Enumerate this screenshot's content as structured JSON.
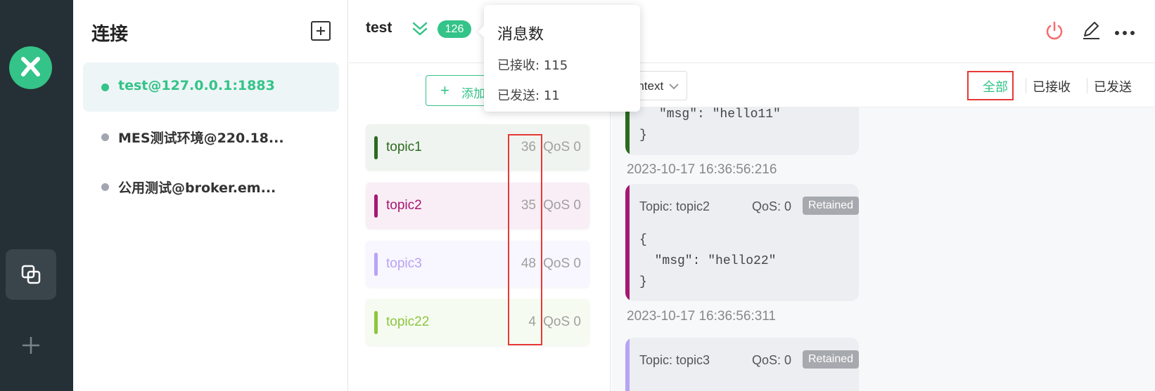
{
  "app": {
    "nav": [
      {
        "name": "connections",
        "icon": "connections-icon"
      },
      {
        "name": "new",
        "icon": "plus-icon"
      }
    ]
  },
  "sidebar": {
    "title": "连接",
    "add_icon": "plus-square-icon",
    "connections": [
      {
        "label": "test@127.0.0.1:1883",
        "status": "connected",
        "status_color": "#34c388"
      },
      {
        "label": "MES测试环境@220.18...",
        "status": "disconnected",
        "status_color": "#a2a6b0"
      },
      {
        "label": "公用测试@broker.em...",
        "status": "disconnected",
        "status_color": "#a2a6b0"
      }
    ]
  },
  "header": {
    "name": "test",
    "message_count": "126",
    "icons": [
      "collapse-icon",
      "power-icon",
      "edit-icon",
      "more-icon"
    ]
  },
  "tooltip": {
    "title": "消息数",
    "received_label": "已接收:",
    "received_value": "115",
    "sent_label": "已发送:",
    "sent_value": "11"
  },
  "topics_panel": {
    "add_button": "添加",
    "topics": [
      {
        "name": "topic1",
        "count": "36",
        "qos": "QoS 0",
        "color": "#2b6b1f",
        "bg": "#f0f4f0"
      },
      {
        "name": "topic2",
        "count": "35",
        "qos": "QoS 0",
        "color": "#a51872",
        "bg": "#f9eef5"
      },
      {
        "name": "topic3",
        "count": "48",
        "qos": "QoS 0",
        "color": "#b8a3f5",
        "bg": "#f8f6fe"
      },
      {
        "name": "topic22",
        "count": "4",
        "qos": "QoS 0",
        "color": "#8cc63f",
        "bg": "#f6fbf1"
      }
    ]
  },
  "messages": {
    "format": "Plaintext",
    "filters": [
      {
        "label": "全部",
        "active": true
      },
      {
        "label": "已接收",
        "active": false
      },
      {
        "label": "已发送",
        "active": false
      }
    ],
    "items": [
      {
        "code_line": "\"msg\": \"hello11\"",
        "code_close": "}",
        "timestamp": "2023-10-17 16:36:56:216",
        "color": "#2b6b1f"
      },
      {
        "topic": "Topic: topic2",
        "qos": "QoS: 0",
        "badge": "Retained",
        "code_open": "{",
        "code_line": "  \"msg\": \"hello22\"",
        "code_close": "}",
        "timestamp": "2023-10-17 16:36:56:311",
        "color": "#a51872"
      },
      {
        "topic": "Topic: topic3",
        "qos": "QoS: 0",
        "badge": "Retained",
        "color": "#b8a3f5"
      }
    ]
  }
}
